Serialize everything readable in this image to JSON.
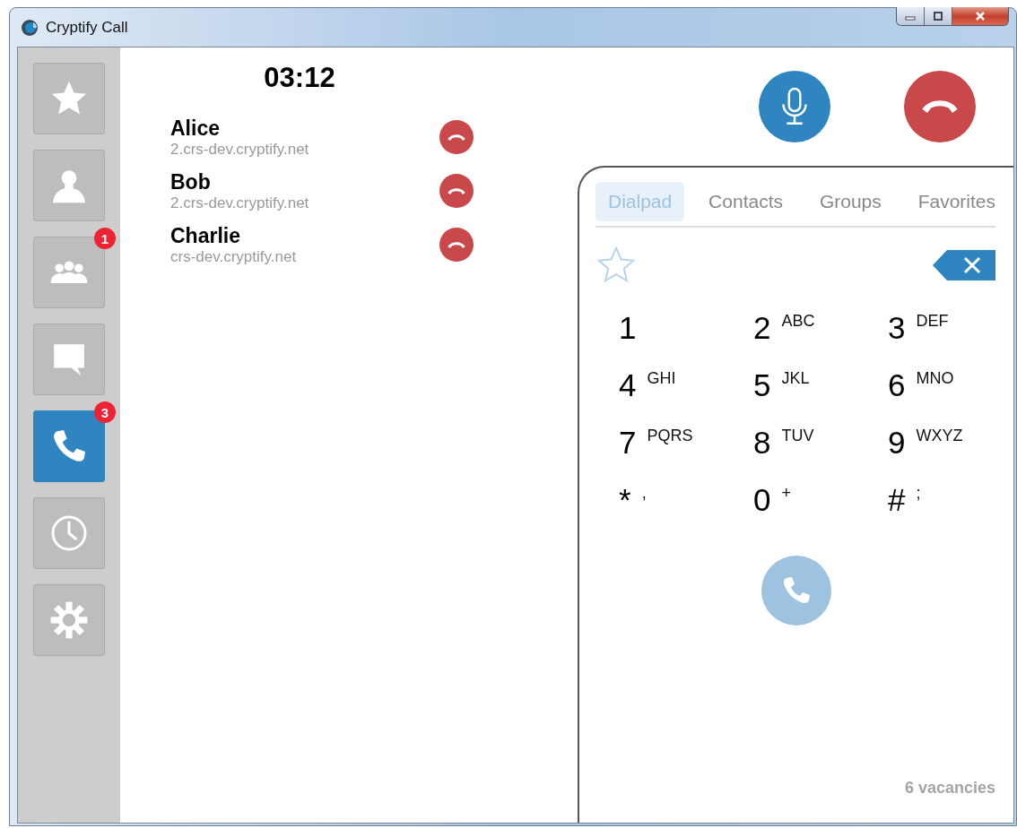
{
  "window": {
    "title": "Cryptify Call"
  },
  "sidebar": {
    "items": [
      {
        "selected": false
      },
      {
        "selected": false
      },
      {
        "selected": false,
        "badge": "1"
      },
      {
        "selected": false
      },
      {
        "selected": true,
        "badge": "3"
      },
      {
        "selected": false
      },
      {
        "selected": false
      }
    ]
  },
  "call": {
    "timer": "03:12",
    "participants": [
      {
        "name": "Alice",
        "host": "2.crs-dev.cryptify.net"
      },
      {
        "name": "Bob",
        "host": "2.crs-dev.cryptify.net"
      },
      {
        "name": "Charlie",
        "host": "crs-dev.cryptify.net"
      }
    ],
    "muted": false
  },
  "dialpad": {
    "tabs": [
      {
        "label": "Dialpad",
        "selected": true
      },
      {
        "label": "Contacts",
        "selected": false
      },
      {
        "label": "Groups",
        "selected": false
      },
      {
        "label": "Favorites",
        "selected": false
      }
    ],
    "favorite": false,
    "keys": [
      {
        "digit": "1"
      },
      {
        "digit": "2",
        "letters": "ABC"
      },
      {
        "digit": "3",
        "letters": "DEF"
      },
      {
        "digit": "4",
        "letters": "GHI"
      },
      {
        "digit": "5",
        "letters": "JKL"
      },
      {
        "digit": "6",
        "letters": "MNO"
      },
      {
        "digit": "7",
        "letters": "PQRS"
      },
      {
        "digit": "8",
        "letters": "TUV"
      },
      {
        "digit": "9",
        "letters": "WXYZ"
      },
      {
        "digit": "*",
        "letters": ","
      },
      {
        "digit": "0",
        "letters": "+"
      },
      {
        "digit": "#",
        "letters": ";"
      }
    ],
    "call_enabled": false,
    "footer": "6 vacancies"
  }
}
